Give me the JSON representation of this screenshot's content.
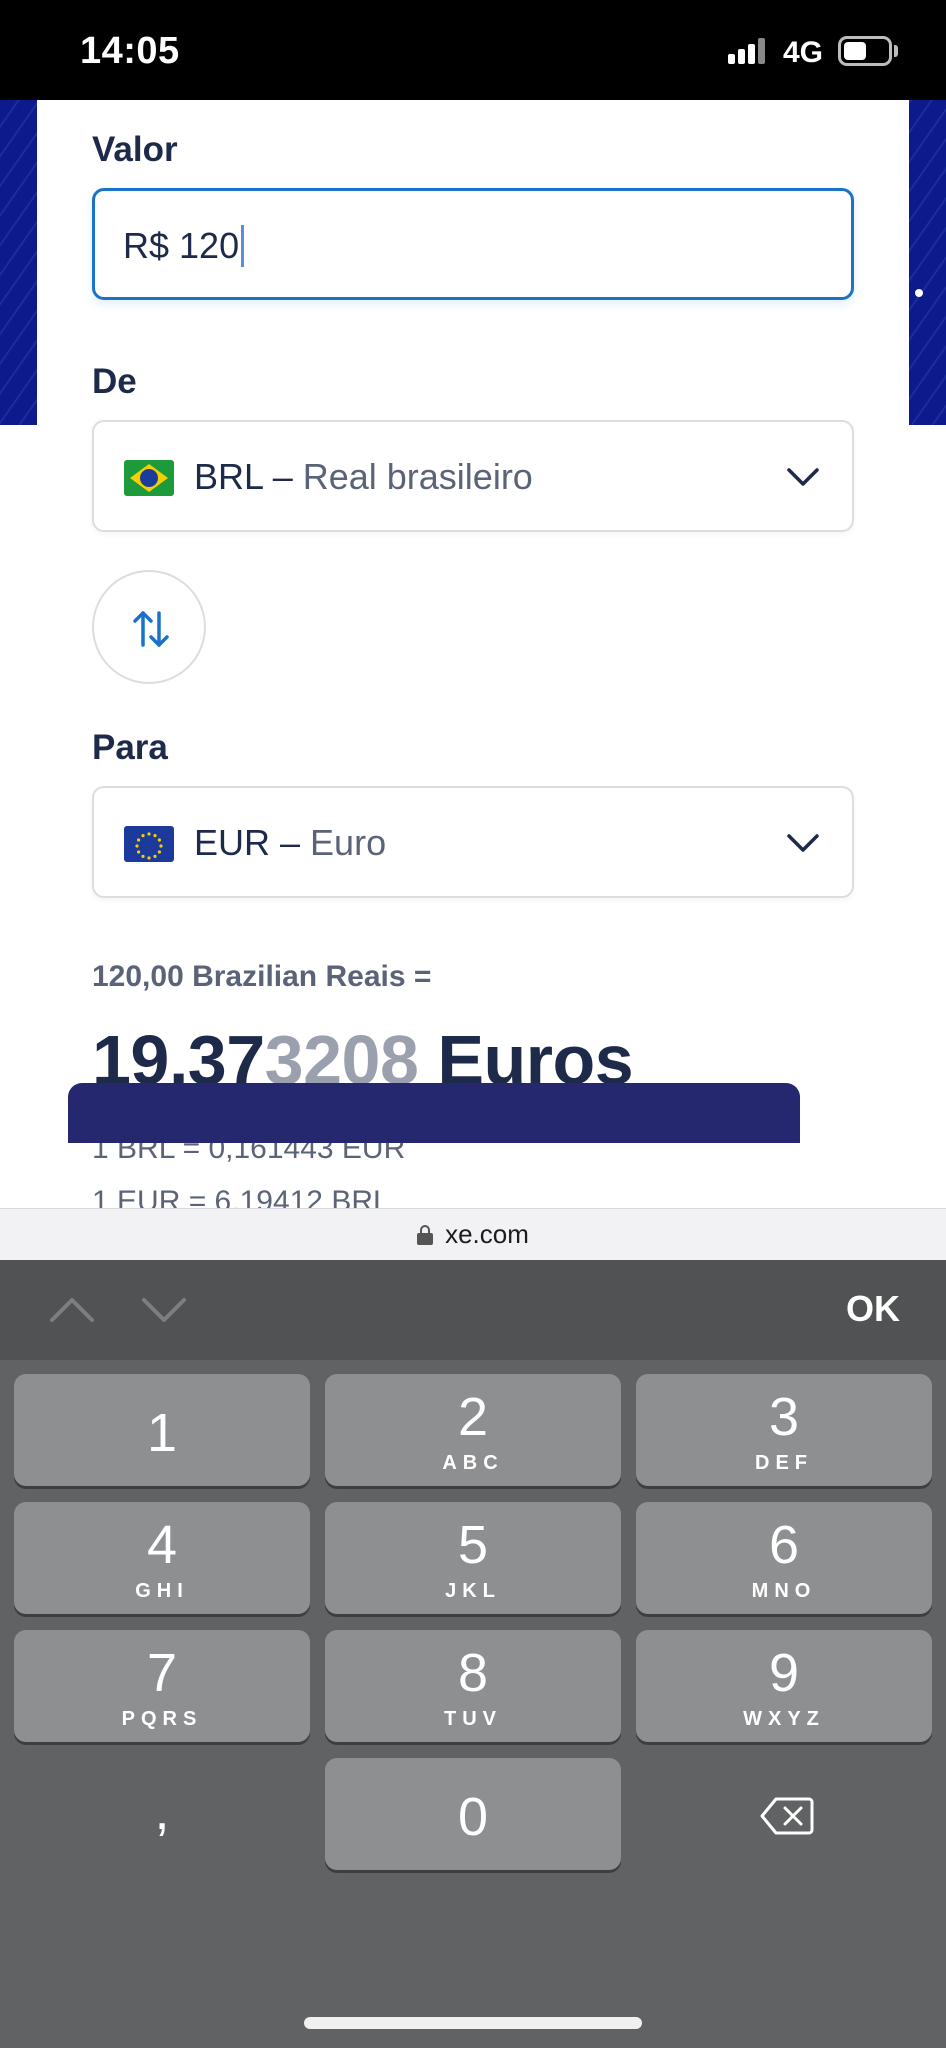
{
  "status_bar": {
    "time": "14:05",
    "network": "4G"
  },
  "converter": {
    "amount_label": "Valor",
    "amount_value": "R$ 120",
    "from_label": "De",
    "from_code": "BRL –",
    "from_name": "Real brasileiro",
    "to_label": "Para",
    "to_code": "EUR –",
    "to_name": "Euro",
    "result_label": "120,00 Brazilian Reais =",
    "result_main": "19,37",
    "result_faded": "3208",
    "result_unit": "Euros",
    "rate_forward": "1 BRL = 0,161443 EUR",
    "rate_reverse": "1 EUR = 6,19412 BRL"
  },
  "browser": {
    "url": "xe.com"
  },
  "keyboard": {
    "ok_label": "OK",
    "keys": [
      {
        "num": "1",
        "letters": ""
      },
      {
        "num": "2",
        "letters": "ABC"
      },
      {
        "num": "3",
        "letters": "DEF"
      },
      {
        "num": "4",
        "letters": "GHI"
      },
      {
        "num": "5",
        "letters": "JKL"
      },
      {
        "num": "6",
        "letters": "MNO"
      },
      {
        "num": "7",
        "letters": "PQRS"
      },
      {
        "num": "8",
        "letters": "TUV"
      },
      {
        "num": "9",
        "letters": "WXYZ"
      },
      {
        "num": "0",
        "letters": ""
      }
    ],
    "comma": ","
  }
}
